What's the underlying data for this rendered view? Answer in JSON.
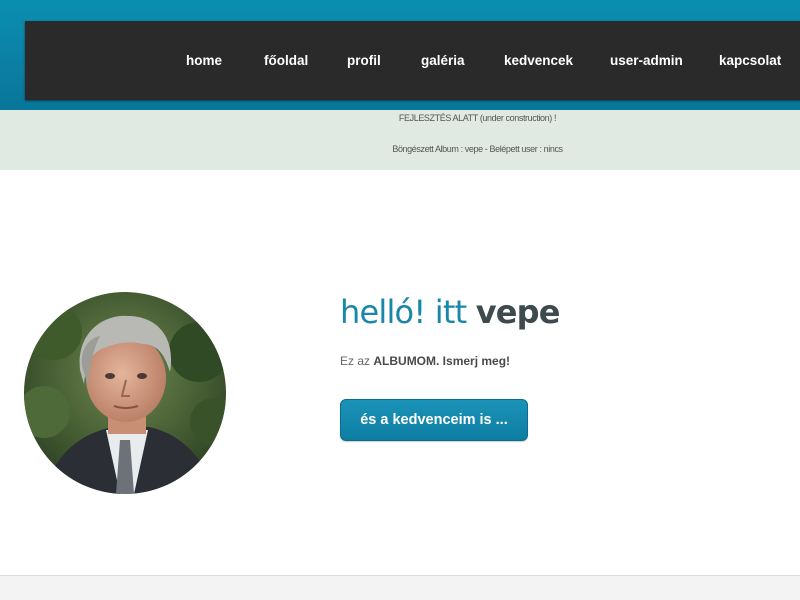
{
  "nav": {
    "items": [
      {
        "label": "home"
      },
      {
        "label": "főoldal"
      },
      {
        "label": "profil"
      },
      {
        "label": "galéria"
      },
      {
        "label": "kedvencek"
      },
      {
        "label": "user-admin"
      },
      {
        "label": "kapcsolat"
      }
    ]
  },
  "info": {
    "notice": "FEJLESZTÉS ALATT (under construction) !",
    "status": "Böngészett Album : vepe  -  Belépett user : nincs"
  },
  "hero": {
    "greeting": "helló! itt ",
    "name": "vepe",
    "sub_prefix": "Ez az ",
    "sub_bold": "ALBUMOM. Ismerj meg!",
    "button_label": "és a kedvenceim is ..."
  },
  "colors": {
    "accent": "#0b7fa3",
    "navbar": "#2a2a2a",
    "info_bar": "#e1e9e3",
    "title": "#1a86a8"
  }
}
